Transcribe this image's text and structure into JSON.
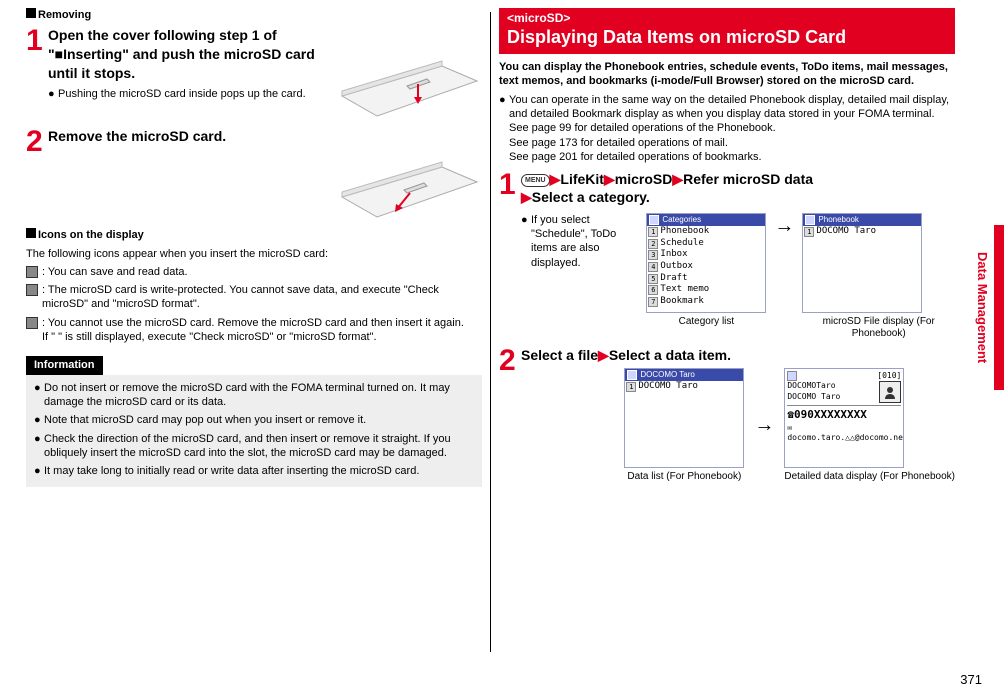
{
  "left": {
    "removing_header": "Removing",
    "step1": {
      "num": "1",
      "title": "Open the cover following step 1 of \"■Inserting\" and push the microSD card until it stops.",
      "bullet": "Pushing the microSD card inside pops up the card."
    },
    "step2": {
      "num": "2",
      "title": "Remove the microSD card."
    },
    "icons_header": "Icons on the display",
    "icons_intro": "The following icons appear when you insert the microSD card:",
    "icon1": ": You can save and read data.",
    "icon2": ": The microSD card is write-protected. You cannot save data, and execute \"Check microSD\" and \"microSD format\".",
    "icon3_a": ": You cannot use the microSD card. Remove the microSD card and then insert it again.",
    "icon3_b": "If \"   \" is still displayed, execute \"Check microSD\" or \"microSD format\".",
    "info_header": "Information",
    "info1": "Do not insert or remove the microSD card with the FOMA terminal turned on. It may damage the microSD card or its data.",
    "info2": "Note that microSD card may pop out when you insert or remove it.",
    "info3": "Check the direction of the microSD card, and then insert or remove it straight. If you obliquely insert the microSD card into the slot, the microSD card may be damaged.",
    "info4": "It may take long to initially read or write data after inserting the microSD card."
  },
  "right": {
    "tag": "<microSD>",
    "title": "Displaying Data Items on microSD Card",
    "intro": "You can display the Phonebook entries, schedule events, ToDo items, mail messages, text memos, and bookmarks (i-mode/Full Browser) stored on the microSD card.",
    "b1": "You can operate in the same way on the detailed Phonebook display, detailed mail display, and detailed Bookmark display as when you display data stored in your FOMA terminal.",
    "b1a": "See page 99 for detailed operations of the Phonebook.",
    "b1b": "See page 173 for detailed operations of mail.",
    "b1c": "See page 201 for detailed operations of bookmarks.",
    "step1": {
      "num": "1",
      "menu": "MENU",
      "p1": "LifeKit",
      "p2": "microSD",
      "p3": "Refer microSD data",
      "p4": "Select a category.",
      "note": "If you select \"Schedule\", ToDo items are also displayed.",
      "cat_title": "Categories",
      "cat_items": [
        "Phonebook",
        "Schedule",
        "Inbox",
        "Outbox",
        "Draft",
        "Text memo",
        "Bookmark"
      ],
      "cat_caption": "Category list",
      "pb_title": "Phonebook",
      "pb_items": [
        "DOCOMO Taro"
      ],
      "pb_caption": "microSD File display (For Phonebook)"
    },
    "step2": {
      "num": "2",
      "title_a": "Select a file",
      "title_b": "Select a data item.",
      "list_title": "DOCOMO Taro",
      "list_items": [
        "DOCOMO Taro"
      ],
      "list_caption": "Data list (For Phonebook)",
      "detail_badge": "[010]",
      "detail_name": "DOCOMOTaro",
      "detail_kana": "DOCOMO Taro",
      "detail_tel": "090XXXXXXXX",
      "detail_mail": "docomo.taro.△△@docomo.ne.jp",
      "detail_caption": "Detailed data display (For Phonebook)"
    }
  },
  "side_tab": "Data Management",
  "page_number": "371"
}
